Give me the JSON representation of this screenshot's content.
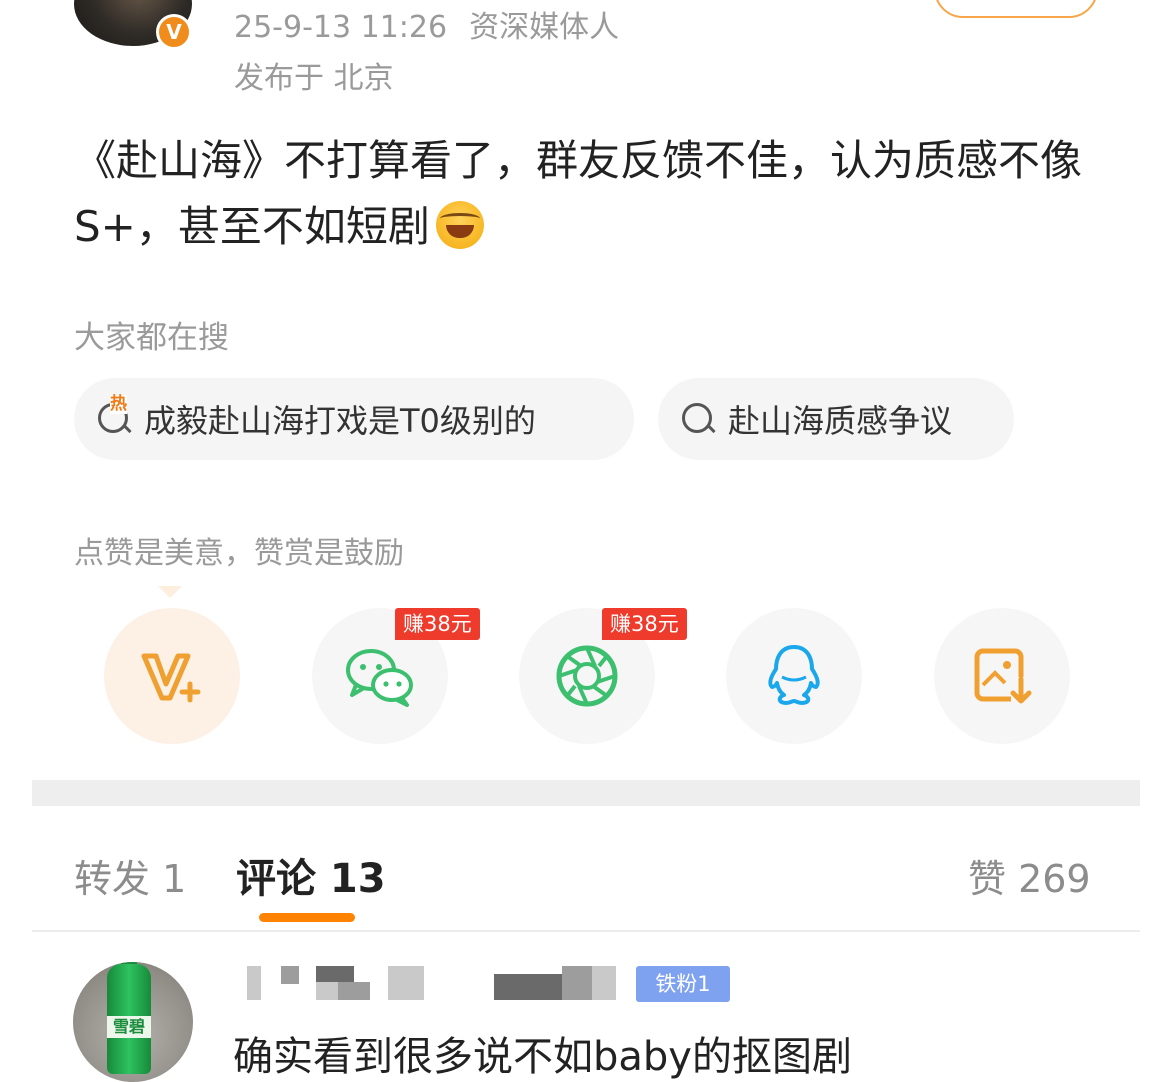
{
  "post": {
    "date": "25-9-13 11:26",
    "author_tag": "资深媒体人",
    "location": "发布于 北京",
    "text": "《赴山海》不打算看了，群友反馈不佳，认为质感不像S+，甚至不如短剧"
  },
  "searches": {
    "heading": "大家都在搜",
    "hot_mark": "热",
    "items": [
      "成毅赴山海打戏是T0级别的",
      "赴山海质感争议"
    ]
  },
  "reward": {
    "text": "点赞是美意，赞赏是鼓励"
  },
  "share": {
    "earn_badge": "赚38元",
    "icons": [
      "vplus-icon",
      "wechat-icon",
      "moments-icon",
      "qq-icon",
      "save-image-icon"
    ],
    "colors": {
      "vplus": "#f0a030",
      "wechat": "#3cbf6e",
      "moments": "#3cbf6e",
      "qq": "#1aa7ec",
      "save": "#f0a030"
    }
  },
  "tabs": {
    "repost": "转发 1",
    "comment": "评论 13",
    "like": "赞 269",
    "accent": "#ff8200"
  },
  "comment": {
    "fan_badge": "铁粉1",
    "avatar_label": "雪碧",
    "text": "确实看到很多说不如baby的抠图剧"
  }
}
